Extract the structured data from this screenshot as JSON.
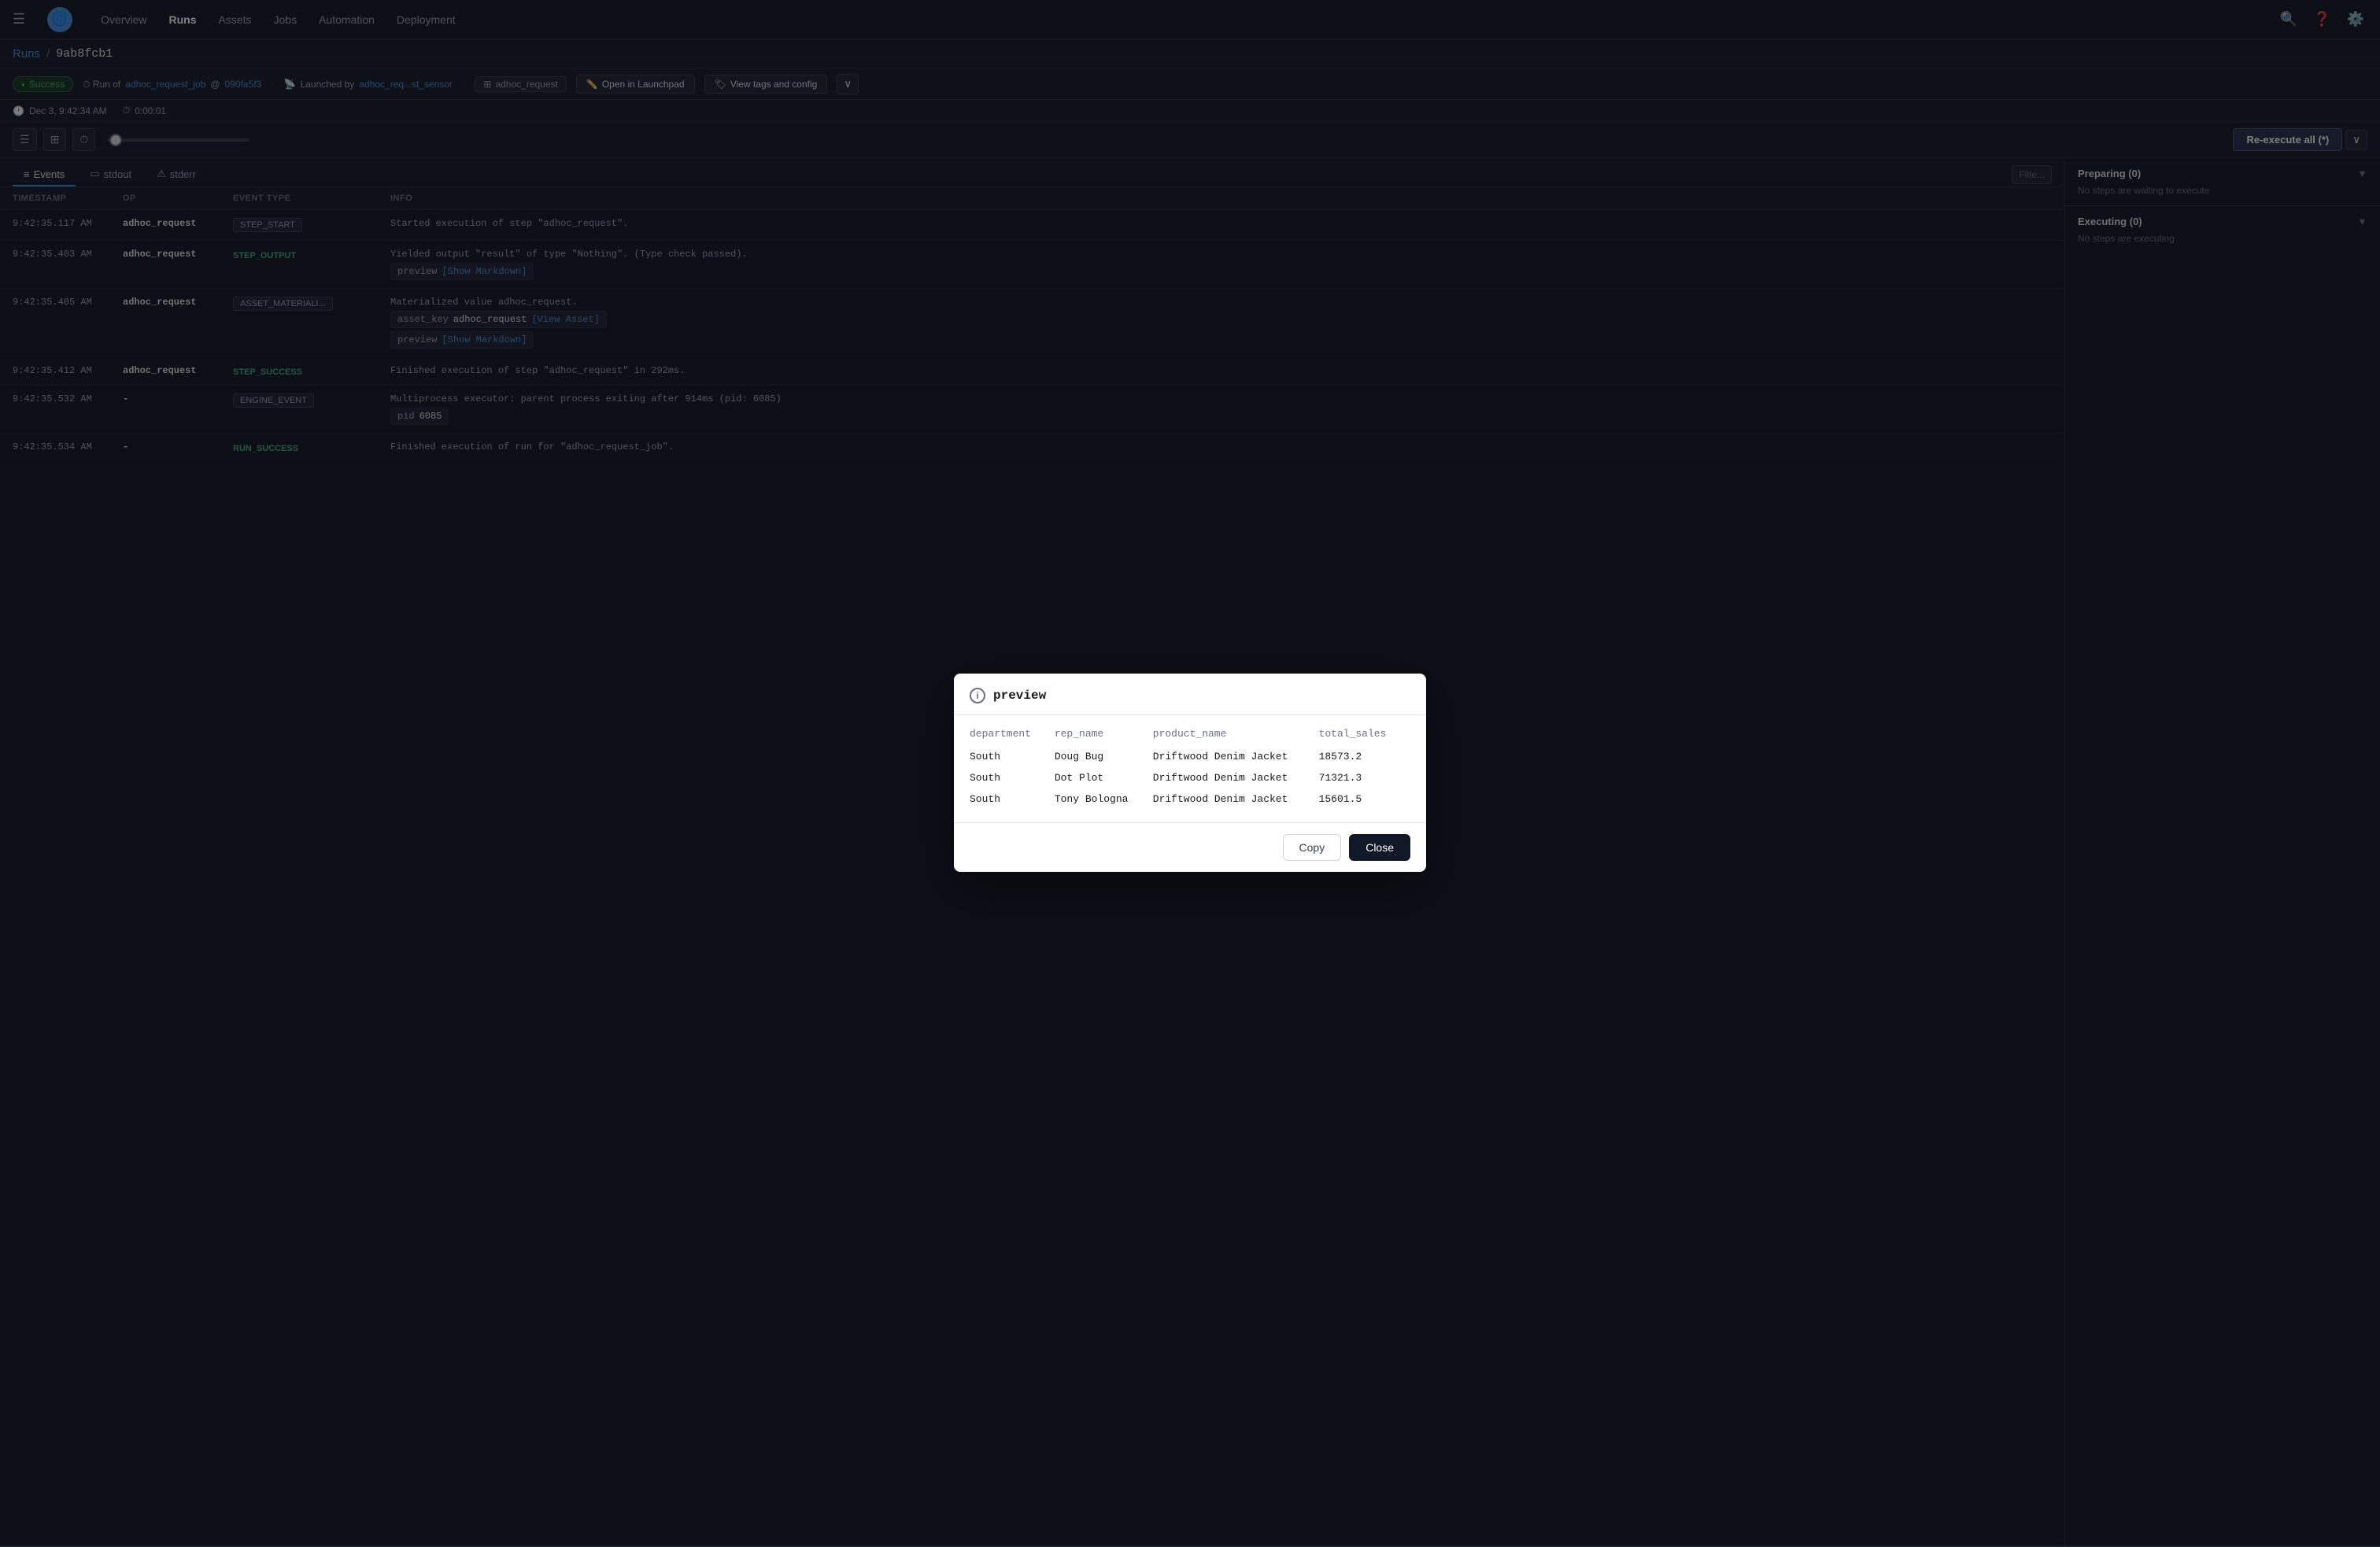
{
  "app": {
    "logo": "🌀",
    "nav": {
      "items": [
        "Overview",
        "Runs",
        "Assets",
        "Jobs",
        "Automation",
        "Deployment"
      ],
      "active": "Runs"
    },
    "icons": {
      "search": "🔍",
      "help": "?",
      "settings": "⚙"
    }
  },
  "breadcrumb": {
    "parent": "Runs",
    "separator": "/",
    "current": "9ab8fcb1"
  },
  "status_bar": {
    "badge": "Success",
    "run_of_label": "Run of",
    "job_link": "adhoc_request_job",
    "at_symbol": "@",
    "commit_link": "090fa5f3",
    "launched_label": "Launched by",
    "sensor_link": "adhoc_req...st_sensor",
    "asset_tag": "adhoc_request",
    "open_launchpad": "Open in Launchpad",
    "view_tags": "View tags and config",
    "chevron": "∨"
  },
  "timestamps": {
    "date": "Dec 3, 9:42:34 AM",
    "duration": "0:00:01"
  },
  "toolbar": {
    "reexecute": "Re-execute all (*)",
    "chevron_up": "∧",
    "chevron_down": "∨"
  },
  "tabs": {
    "items": [
      "Events",
      "stdout",
      "stderr"
    ],
    "active": "Events",
    "filter_placeholder": "Filte..."
  },
  "table": {
    "headers": [
      "TIMESTAMP",
      "OP",
      "EVENT TYPE",
      "INFO"
    ],
    "rows": [
      {
        "timestamp": "9:42:35.117 AM",
        "op": "adhoc_request",
        "event_type": "STEP_START",
        "event_type_class": "badge-step-start",
        "info": "Started execution of step \"adhoc_request\".",
        "sub_items": []
      },
      {
        "timestamp": "9:42:35.403 AM",
        "op": "adhoc_request",
        "event_type": "STEP_OUTPUT",
        "event_type_class": "badge-step-output",
        "info": "Yielded output \"result\" of type \"Nothing\". (Type check passed).",
        "sub_items": [
          {
            "label": "preview",
            "link": "[Show Markdown]",
            "link_text": "[Show Markdown]"
          }
        ]
      },
      {
        "timestamp": "9:42:35.405 AM",
        "op": "adhoc_request",
        "event_type": "ASSET_MATERIALI...",
        "event_type_class": "badge-asset-mat",
        "info": "Materialized value adhoc_request.",
        "sub_items": [
          {
            "label": "asset_key",
            "value": "adhoc_request",
            "link": "[View Asset]",
            "link_text": "[View Asset]"
          },
          {
            "label": "preview",
            "link": "[Show Markdown]",
            "link_text": "[Show Markdown]"
          }
        ]
      },
      {
        "timestamp": "9:42:35.412 AM",
        "op": "adhoc_request",
        "event_type": "STEP_SUCCESS",
        "event_type_class": "badge-step-success",
        "info": "Finished execution of step \"adhoc_request\" in 292ms.",
        "sub_items": []
      },
      {
        "timestamp": "9:42:35.532 AM",
        "op": "-",
        "event_type": "ENGINE_EVENT",
        "event_type_class": "badge-engine",
        "info": "Multiprocess executor: parent process exiting after 914ms (pid: 6085)",
        "sub_items": [
          {
            "label": "pid",
            "value": "6085"
          }
        ]
      },
      {
        "timestamp": "9:42:35.534 AM",
        "op": "-",
        "event_type": "RUN_SUCCESS",
        "event_type_class": "badge-run-success",
        "info": "Finished execution of run for \"adhoc_request_job\".",
        "sub_items": []
      }
    ]
  },
  "right_panel": {
    "preparing_title": "Preparing (0)",
    "preparing_msg": "No steps are waiting to execute",
    "executing_title": "Executing (0)",
    "executing_msg": "No steps are executing"
  },
  "modal": {
    "visible": true,
    "title": "preview",
    "info_icon": "i",
    "table": {
      "headers": [
        "department",
        "rep_name",
        "product_name",
        "total_sales"
      ],
      "rows": [
        [
          "South",
          "Doug Bug",
          "Driftwood Denim Jacket",
          "18573.2"
        ],
        [
          "South",
          "Dot Plot",
          "Driftwood Denim Jacket",
          "71321.3"
        ],
        [
          "South",
          "Tony Bologna",
          "Driftwood Denim Jacket",
          "15601.5"
        ]
      ]
    },
    "copy_label": "Copy",
    "close_label": "Close"
  }
}
